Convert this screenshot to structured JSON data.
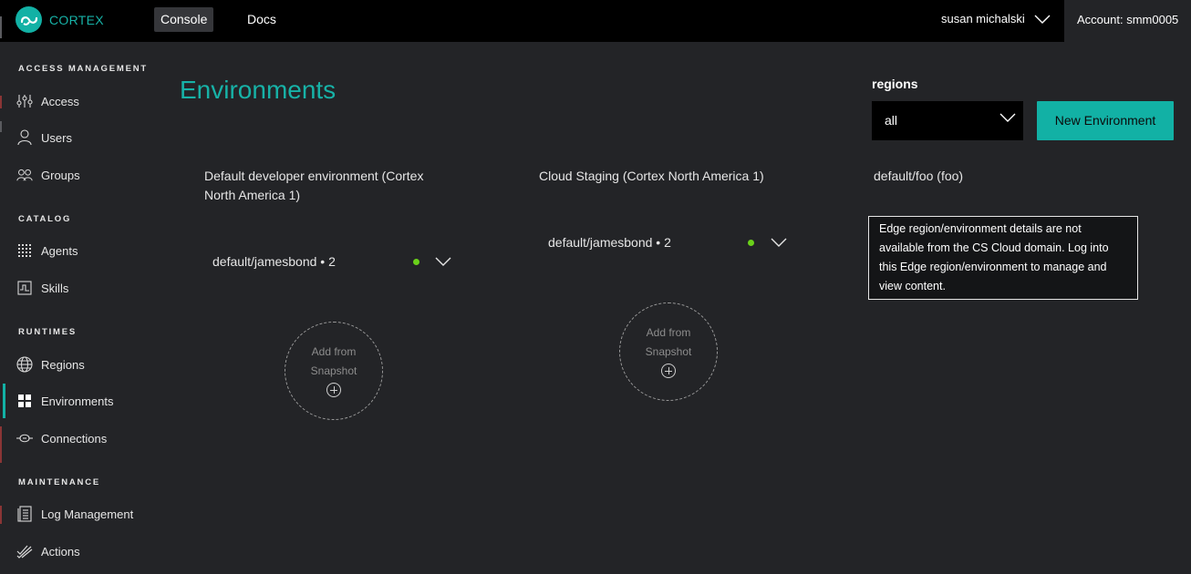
{
  "topbar": {
    "brand": "CORTEX",
    "tabs": [
      {
        "label": "Console",
        "active": true
      },
      {
        "label": "Docs",
        "active": false
      }
    ],
    "user_name": "susan michalski",
    "account_label": "Account: smm0005"
  },
  "sidebar": {
    "sections": [
      {
        "title": "ACCESS MANAGEMENT",
        "items": [
          {
            "label": "Access",
            "icon": "sliders-icon"
          },
          {
            "label": "Users",
            "icon": "user-icon"
          },
          {
            "label": "Groups",
            "icon": "group-icon"
          }
        ]
      },
      {
        "title": "CATALOG",
        "items": [
          {
            "label": "Agents",
            "icon": "agents-icon"
          },
          {
            "label": "Skills",
            "icon": "skills-icon"
          }
        ]
      },
      {
        "title": "RUNTIMES",
        "items": [
          {
            "label": "Regions",
            "icon": "globe-icon"
          },
          {
            "label": "Environments",
            "icon": "grid-icon",
            "active": true
          },
          {
            "label": "Connections",
            "icon": "connections-icon"
          }
        ]
      },
      {
        "title": "MAINTENANCE",
        "items": [
          {
            "label": "Log Management",
            "icon": "logs-icon"
          },
          {
            "label": "Actions",
            "icon": "actions-icon"
          }
        ]
      }
    ]
  },
  "main": {
    "title": "Environments",
    "regions_label": "regions",
    "regions_value": "all",
    "new_env_label": "New Environment",
    "environments": [
      {
        "title_line1": "Default developer environment (Cortex",
        "title_line2": "North America 1)",
        "namespace": "default/jamesbond • 2",
        "status": "green",
        "snapshot_line1": "Add from",
        "snapshot_line2": "Snapshot"
      },
      {
        "title_line1": "Cloud Staging (Cortex North America 1)",
        "namespace": "default/jamesbond • 2",
        "status": "green",
        "snapshot_line1": "Add from",
        "snapshot_line2": "Snapshot"
      },
      {
        "title_line1": "default/foo (foo)",
        "note_lines": [
          "Edge region/environment details are not",
          "available from the CS Cloud domain. Log into",
          "this Edge region/environment to manage and",
          "view content."
        ]
      }
    ]
  },
  "colors": {
    "accent": "#12b1a5",
    "status_ok": "#6ad11a",
    "background": "#232427",
    "topbar": "#000000"
  }
}
